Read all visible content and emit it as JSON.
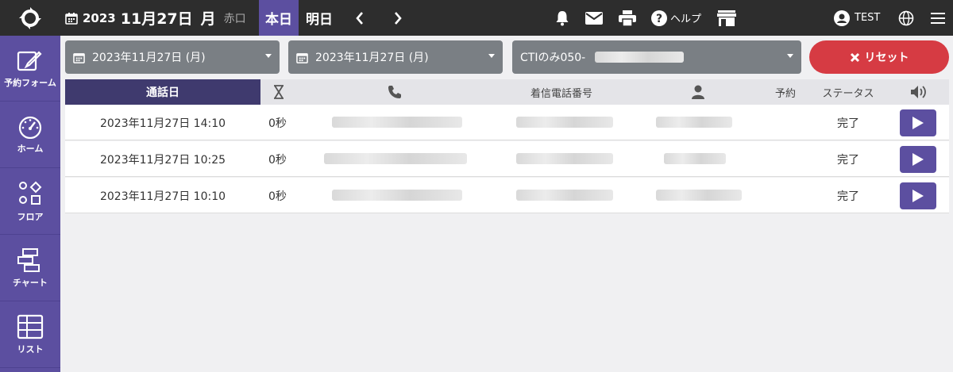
{
  "header": {
    "year": "2023",
    "month_day": "11月27日",
    "weekday": "月",
    "rokuyo": "赤口",
    "today_label": "本日",
    "tomorrow_label": "明日",
    "help_label": "ヘルプ",
    "user_label": "TEST"
  },
  "sidebar": {
    "items": [
      {
        "label": "予約フォーム",
        "icon": "edit-icon"
      },
      {
        "label": "ホーム",
        "icon": "gauge-icon"
      },
      {
        "label": "フロア",
        "icon": "shapes-icon"
      },
      {
        "label": "チャート",
        "icon": "chart-icon"
      },
      {
        "label": "リスト",
        "icon": "table-icon"
      }
    ]
  },
  "filters": {
    "start_date": "2023年11月27日 (月)",
    "end_date": "2023年11月27日 (月)",
    "mode": "CTIのみ050-",
    "reset_label": "リセット"
  },
  "table": {
    "headers": {
      "date": "通話日",
      "incoming_number": "着信電話番号",
      "reservation": "予約",
      "status": "ステータス"
    },
    "rows": [
      {
        "date": "2023年11月27日 14:10",
        "duration": "0秒",
        "status": "完了"
      },
      {
        "date": "2023年11月27日 10:25",
        "duration": "0秒",
        "status": "完了"
      },
      {
        "date": "2023年11月27日 10:10",
        "duration": "0秒",
        "status": "完了"
      }
    ]
  },
  "colors": {
    "accent": "#5c4fa0",
    "topbar": "#2d2d2d",
    "reset": "#d63b43",
    "filter": "#7a7f84"
  }
}
